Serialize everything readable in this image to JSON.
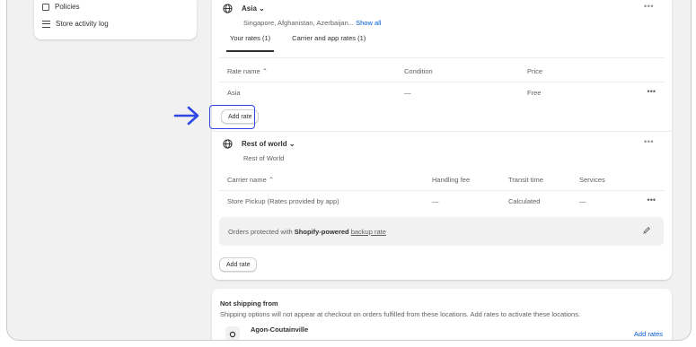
{
  "sidebar": {
    "items": [
      {
        "label": "Policies",
        "icon": "policy-icon"
      },
      {
        "label": "Store activity log",
        "icon": "list-icon"
      }
    ]
  },
  "zones": [
    {
      "name": "Asia",
      "countries": "Singapore, Afghanistan, Azerbaijan...",
      "show_all": "Show all",
      "tabs": [
        {
          "label": "Your rates (1)",
          "active": true
        },
        {
          "label": "Carrier and app rates (1)",
          "active": false
        }
      ],
      "columns": [
        "Rate name",
        "Condition",
        "Price"
      ],
      "rows": [
        {
          "name": "Asia",
          "condition": "—",
          "price": "Free"
        }
      ],
      "add_rate": "Add rate"
    },
    {
      "name": "Rest of world",
      "subtitle": "Rest of World",
      "columns": [
        "Carrier name",
        "Handling fee",
        "Transit time",
        "Services"
      ],
      "rows": [
        {
          "name": "Store Pickup (Rates provided by app)",
          "fee": "—",
          "transit": "Calculated",
          "services": "—"
        }
      ],
      "banner": {
        "prefix": "Orders protected with ",
        "bold": "Shopify-powered",
        "link": "backup rate"
      },
      "add_rate": "Add rate"
    }
  ],
  "not_shipping": {
    "title": "Not shipping from",
    "description": "Shipping options will not appear at checkout on orders fulfilled from these locations. Add rates to activate these locations.",
    "location": "Agon-Coutainville",
    "add_rates": "Add rates"
  },
  "colors": {
    "highlight": "#2f47e4",
    "link": "#005bd3",
    "background": "#f1f1f1"
  }
}
